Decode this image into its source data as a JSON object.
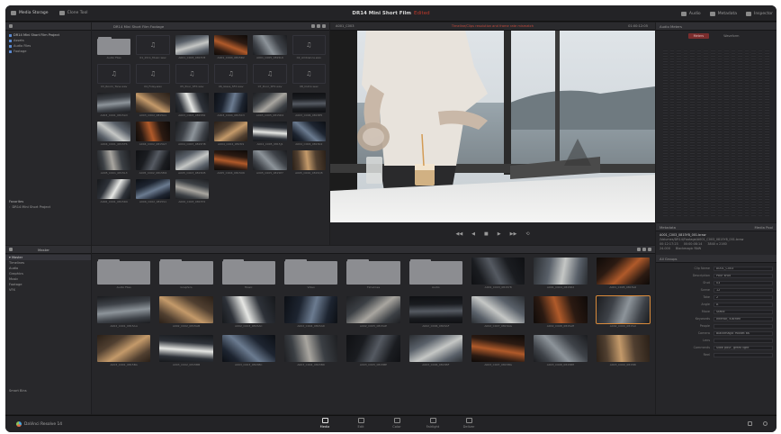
{
  "window": {
    "project_title": "DR14 Mini Short Film",
    "edited_label": "Edited",
    "top_left": [
      {
        "label": "Media Storage",
        "icon": "media-storage-icon"
      },
      {
        "label": "Clone Tool",
        "icon": "clone-icon"
      }
    ],
    "top_right": [
      {
        "label": "Audio",
        "icon": "audio-icon"
      },
      {
        "label": "Metadata",
        "icon": "metadata-icon"
      },
      {
        "label": "Inspector",
        "icon": "inspector-icon"
      }
    ]
  },
  "media_storage": {
    "volumes": [
      "DR14 Mini Short Film Project",
      "Assets",
      "Audio Files",
      "Footage"
    ],
    "favorites_label": "Favorites",
    "favorites_items": [
      "DR14 Mini Short Project"
    ],
    "path_label": "DR14 Mini Short Film Footage",
    "browser_items": [
      {
        "type": "folder",
        "label": "Audio Files"
      },
      {
        "type": "audio",
        "label": "01_Intro_Music.wav"
      },
      {
        "type": "clip",
        "label": "A001_C003_0815Y8"
      },
      {
        "type": "clip",
        "label": "A001_C004_0815R2"
      },
      {
        "type": "clip",
        "label": "A001_C005_0815L6"
      },
      {
        "type": "audio",
        "label": "02_Ambience.wav"
      },
      {
        "type": "audio",
        "label": "03_Room_Tone.wav"
      },
      {
        "type": "audio",
        "label": "04_Foley.wav"
      },
      {
        "type": "audio",
        "label": "05_Pour_SFX.wav"
      },
      {
        "type": "audio",
        "label": "06_Glass_SFX.wav"
      },
      {
        "type": "audio",
        "label": "07_Door_SFX.wav"
      },
      {
        "type": "audio",
        "label": "08_Outro.wav"
      },
      {
        "type": "clip",
        "label": "A003_C001_0815LD"
      },
      {
        "type": "clip",
        "label": "A003_C002_0815A1"
      },
      {
        "type": "clip",
        "label": "A003_C003_0815B2"
      },
      {
        "type": "clip",
        "label": "A003_C004_0815C3"
      },
      {
        "type": "clip",
        "label": "A003_C005_0815D4"
      },
      {
        "type": "clip",
        "label": "A003_C006_0815E5"
      },
      {
        "type": "clip",
        "label": "A004_C001_0815F6"
      },
      {
        "type": "clip",
        "label": "A004_C002_0815G7"
      },
      {
        "type": "clip",
        "label": "A004_C003_0815H8"
      },
      {
        "type": "clip",
        "label": "A004_C004_0815I9"
      },
      {
        "type": "clip",
        "label": "A004_C005_0815J1"
      },
      {
        "type": "clip",
        "label": "A004_C006_0815K2"
      },
      {
        "type": "clip",
        "label": "A005_C001_0815L3"
      },
      {
        "type": "clip",
        "label": "A005_C002_0815M4"
      },
      {
        "type": "clip",
        "label": "A005_C003_0815N5"
      },
      {
        "type": "clip",
        "label": "A005_C004_0815O6"
      },
      {
        "type": "clip",
        "label": "A005_C005_0815P7"
      },
      {
        "type": "clip",
        "label": "A005_C006_0815Q8"
      },
      {
        "type": "clip",
        "label": "A006_C001_0815R9"
      },
      {
        "type": "clip",
        "label": "A006_C002_0815S1"
      },
      {
        "type": "clip",
        "label": "A006_C003_0815T2"
      }
    ]
  },
  "viewer": {
    "clip_name": "A001_C003",
    "warning": "Timeline/Clips resolution and frame rate mismatch",
    "timecode": "01:00:12:05",
    "controls": [
      "◀◀",
      "◀",
      "■",
      "▶",
      "▶▶",
      "⟲"
    ]
  },
  "audio_panel": {
    "title": "Audio Meters",
    "tabs": [
      "Meters",
      "Waveform"
    ]
  },
  "metadata_panel": {
    "title": "Metadata",
    "tab": "Media Pool",
    "clip_file": "A001_C003_0815Y8_001.braw",
    "clip_path": "/Volumes/DR14/Footage/A001_C003_0815Y8_001.braw",
    "tc_start": "00:12:17:23",
    "duration": "00:00:08:14",
    "resolution": "3840 x 2160",
    "fps": "24.000",
    "codec": "Blackmagic RAW",
    "section": "All Groups",
    "fields": [
      {
        "k": "Clip Name",
        "v": "A001_C003"
      },
      {
        "k": "Description",
        "v": "Pour shot"
      },
      {
        "k": "Shot",
        "v": "03"
      },
      {
        "k": "Scene",
        "v": "12"
      },
      {
        "k": "Take",
        "v": "2"
      },
      {
        "k": "Angle",
        "v": "A"
      },
      {
        "k": "Move",
        "v": "Static"
      },
      {
        "k": "Keywords",
        "v": "Interior, Kitchen"
      },
      {
        "k": "People",
        "v": ""
      },
      {
        "k": "Camera",
        "v": "Blackmagic Pocket 6K"
      },
      {
        "k": "Lens",
        "v": ""
      },
      {
        "k": "Comments",
        "v": "Slow pour, great light"
      },
      {
        "k": "Reel",
        "v": ""
      }
    ]
  },
  "media_pool": {
    "title": "Master",
    "bins": [
      "Master",
      "Timelines",
      "Audio",
      "Graphics",
      "Music",
      "Footage",
      "VFX"
    ],
    "smart_bins_label": "Smart Bins",
    "items": [
      {
        "type": "folder",
        "label": "Audio Files"
      },
      {
        "type": "folder",
        "label": "Graphics"
      },
      {
        "type": "folder",
        "label": "Music"
      },
      {
        "type": "folder",
        "label": "Video"
      },
      {
        "type": "folder",
        "label": "Timelines"
      },
      {
        "type": "folder",
        "label": "Audio"
      },
      {
        "type": "clip",
        "label": "A001_C003_0815Y8"
      },
      {
        "type": "clip",
        "label": "A001_C004_0815R2"
      },
      {
        "type": "clip",
        "label": "A001_C005_0815L6"
      },
      {
        "type": "clip",
        "label": "A002_C001_0815AA"
      },
      {
        "type": "clip",
        "label": "A002_C002_0815AB"
      },
      {
        "type": "clip",
        "label": "A002_C003_0815AC"
      },
      {
        "type": "clip",
        "label": "A002_C004_0815AD"
      },
      {
        "type": "clip",
        "label": "A002_C005_0815AE"
      },
      {
        "type": "clip",
        "label": "A002_C006_0815AF"
      },
      {
        "type": "clip",
        "label": "A002_C007_0815AG"
      },
      {
        "type": "clip",
        "label": "A002_C008_0815AH"
      },
      {
        "type": "clip",
        "label": "A002_C009_0815AI"
      },
      {
        "type": "clip",
        "label": "A003_C001_0815BA"
      },
      {
        "type": "clip",
        "label": "A003_C002_0815BB"
      },
      {
        "type": "clip",
        "label": "A003_C003_0815BC"
      },
      {
        "type": "clip",
        "label": "A003_C004_0815BD"
      },
      {
        "type": "clip",
        "label": "A003_C005_0815BE"
      },
      {
        "type": "clip",
        "label": "A003_C006_0815BF"
      },
      {
        "type": "clip",
        "label": "A003_C007_0815BG"
      },
      {
        "type": "clip",
        "label": "A003_C008_0815BH"
      },
      {
        "type": "clip",
        "label": "A003_C009_0815BI"
      }
    ]
  },
  "bottom": {
    "app_name": "DaVinci Resolve 14",
    "pages": [
      {
        "label": "Media",
        "active": true
      },
      {
        "label": "Edit",
        "active": false
      },
      {
        "label": "Color",
        "active": false
      },
      {
        "label": "Fairlight",
        "active": false
      },
      {
        "label": "Deliver",
        "active": false
      }
    ]
  },
  "colors": {
    "accent_blue": "#5b8bd4",
    "warning_red": "#c64a3c",
    "selected_clip": "#d98a3a"
  }
}
